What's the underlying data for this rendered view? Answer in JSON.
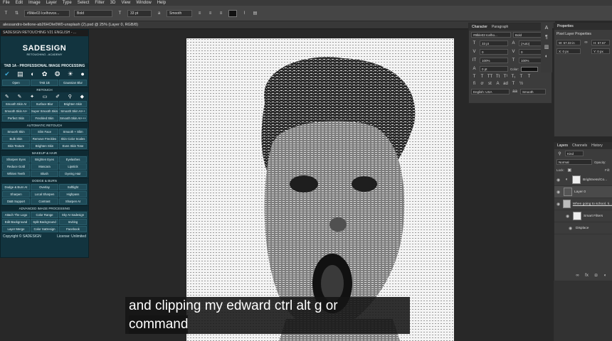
{
  "menubar": {
    "items": [
      "File",
      "Edit",
      "Image",
      "Layer",
      "Type",
      "Select",
      "Filter",
      "3D",
      "View",
      "Window",
      "Help"
    ]
  },
  "options": {
    "font_family": "#9lkle03 Icelhovce...",
    "font_style": "Bold",
    "font_size": "33 pt",
    "antialias": "Smooth"
  },
  "document": {
    "tab_title": "alessandro-bellone-ab26HOIe0W0-unsplash (2).psd @ 25% (Layer 0, RGB/8)"
  },
  "plugin": {
    "window_title": "SADESIGN RETOUCHING V21 ENGLISH - ...",
    "logo_name": "SADESIGN",
    "logo_sub": "RETOUCHING - ACADEMY",
    "panel_heading": "TAB 1A - PROFESSIONAL IMAGE PROCESSING",
    "top_row": [
      "Open",
      "TAB 1B",
      "Gaussian Blur"
    ],
    "retouch_title": "RETOUCH",
    "retouch": [
      "Smooth Skin AI",
      "Surface Blur",
      "Brighten Skin",
      "Smooth Skin AI+",
      "Super Smooth Skin",
      "Smooth Skin AI++",
      "Perfect Skin",
      "Freckled Skin",
      "Smooth Skin AI+++"
    ],
    "auto_title": "AUTOMATIC RETOUCH",
    "auto": [
      "Smooth Skin",
      "Slim Face",
      "Smooth + Slim",
      "Bulk Skin",
      "Remove Freckles",
      "Skin Color Scales",
      "Skin Texture",
      "Brighten Skin",
      "Even Skin Tone"
    ],
    "makeup_title": "MAKEUP & HAIR",
    "makeup": [
      "Sharpen Eyes",
      "Brighten Eyes",
      "Eyelashes",
      "Reduce Gold",
      "Mascara",
      "Lipstick",
      "Whiten Teeth",
      "Blush",
      "Dyeing Hair"
    ],
    "dodge_title": "DODGE & BURN",
    "dodge": [
      "Dodge & Burn AI",
      "Overlay",
      "Softlight",
      "Sharpen",
      "Local Sharpen",
      "Highpass",
      "D&B Support",
      "Contrast",
      "Sharpen AI"
    ],
    "adv_title": "ADVANCED IMAGE PROCESSING",
    "adv": [
      "Attach The Logo",
      "Color Range",
      "Sky AI Sadesign",
      "Edit Background",
      "Split Background",
      "Inviting",
      "Layer Merge",
      "Color SaDesign",
      "Facebook"
    ],
    "copyright": "Copyright © SADESIGN",
    "license": "License: Unlimited"
  },
  "character": {
    "tab_character": "Character",
    "tab_paragraph": "Paragraph",
    "font_family": "#9lkle03 Icelho...",
    "font_style": "Bold",
    "size": "33 pt",
    "leading": "(Auto)",
    "kerning": "0",
    "tracking": "0",
    "vscale": "100%",
    "hscale": "100%",
    "baseline": "0 pt",
    "color_label": "Color:",
    "language": "English: USA",
    "aa": "Smooth"
  },
  "properties": {
    "tab": "Properties",
    "subtitle": "Pixel Layer Properties",
    "w": "W: 57.33 in",
    "h": "H: 67.67",
    "x": "X: 0 px",
    "y": "Y: 0 px"
  },
  "layers": {
    "tab_layers": "Layers",
    "tab_channels": "Channels",
    "tab_history": "History",
    "kind": "Kind",
    "blend": "Normal",
    "opacity": "Opacity:",
    "lock": "Lock:",
    "fill": "Fill:",
    "items": [
      "Brightness/Co...",
      "Layer 0",
      "When going to school, ti...",
      "Smart Filters",
      "Displace"
    ]
  },
  "caption": {
    "line1": "and clipping my edward ctrl alt g or",
    "line2": "command"
  },
  "colors": {
    "plugin_bg": "#12343f",
    "plugin_btn": "#1f4b58",
    "ps_panel": "#3c3c3c",
    "canvas": "#282828"
  }
}
